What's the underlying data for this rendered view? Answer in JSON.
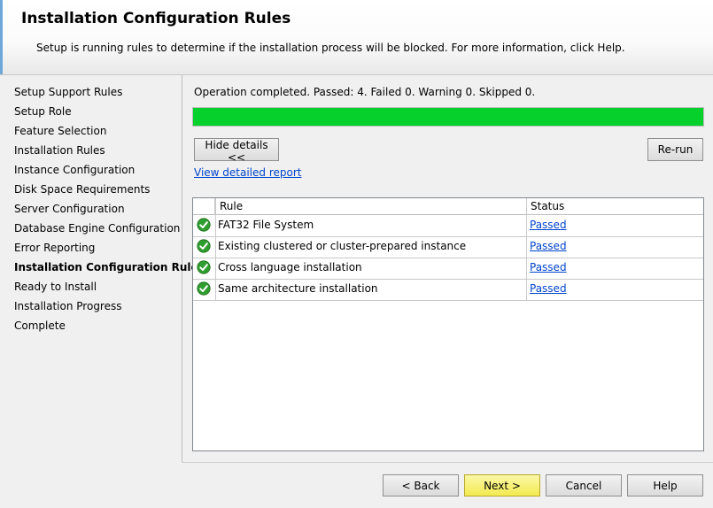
{
  "header": {
    "title": "Installation Configuration Rules",
    "subtitle": "Setup is running rules to determine if the installation process will be blocked. For more information, click Help."
  },
  "nav": {
    "items": [
      {
        "label": "Setup Support Rules"
      },
      {
        "label": "Setup Role"
      },
      {
        "label": "Feature Selection"
      },
      {
        "label": "Installation Rules"
      },
      {
        "label": "Instance Configuration"
      },
      {
        "label": "Disk Space Requirements"
      },
      {
        "label": "Server Configuration"
      },
      {
        "label": "Database Engine Configuration"
      },
      {
        "label": "Error Reporting"
      },
      {
        "label": "Installation Configuration Rules",
        "current": true
      },
      {
        "label": "Ready to Install"
      },
      {
        "label": "Installation Progress"
      },
      {
        "label": "Complete"
      }
    ]
  },
  "main": {
    "status": "Operation completed. Passed: 4.   Failed 0.   Warning 0.   Skipped 0.",
    "progress": 1.0,
    "progress_color": "#06d02c",
    "hide_details_label": "Hide details <<",
    "rerun_label": "Re-run",
    "detail_link": "View detailed report",
    "table": {
      "headers": {
        "rule": "Rule",
        "status": "Status"
      },
      "rows": [
        {
          "rule": "FAT32 File System",
          "status": "Passed",
          "icon": "check-icon"
        },
        {
          "rule": "Existing clustered or cluster-prepared instance",
          "status": "Passed",
          "icon": "check-icon"
        },
        {
          "rule": "Cross language installation",
          "status": "Passed",
          "icon": "check-icon"
        },
        {
          "rule": "Same architecture installation",
          "status": "Passed",
          "icon": "check-icon"
        }
      ]
    }
  },
  "footer": {
    "back_label": "< Back",
    "next_label": "Next >",
    "cancel_label": "Cancel",
    "help_label": "Help"
  }
}
